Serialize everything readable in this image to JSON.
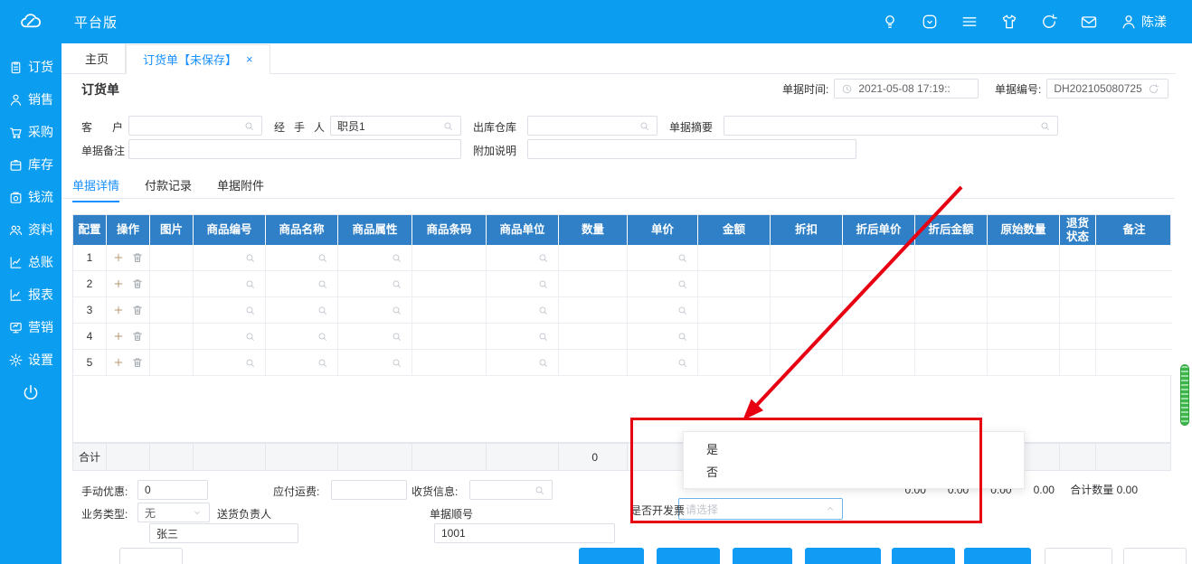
{
  "topbar": {
    "brand": "平台版",
    "user": "陈漾",
    "icons": [
      "bulb-icon",
      "checkbox-icon",
      "menu-icon",
      "shirt-icon",
      "refresh-icon",
      "mail-icon",
      "user-icon"
    ]
  },
  "sidebar": {
    "items": [
      {
        "label": "订货",
        "icon": "clipboard-icon"
      },
      {
        "label": "销售",
        "icon": "person-icon"
      },
      {
        "label": "采购",
        "icon": "cart-icon"
      },
      {
        "label": "库存",
        "icon": "box-icon"
      },
      {
        "label": "钱流",
        "icon": "cash-icon"
      },
      {
        "label": "资料",
        "icon": "people-icon"
      },
      {
        "label": "总账",
        "icon": "ledger-chart-icon"
      },
      {
        "label": "报表",
        "icon": "report-chart-icon"
      },
      {
        "label": "营销",
        "icon": "monitor-icon"
      },
      {
        "label": "设置",
        "icon": "gear-icon"
      }
    ]
  },
  "tabs": [
    {
      "label": "主页",
      "active": false
    },
    {
      "label": "订货单【未保存】",
      "active": true,
      "close": "×"
    }
  ],
  "page_title": "订货单",
  "doc_header": {
    "time_label": "单据时间:",
    "time_value": "2021-05-08 17:19::",
    "number_label": "单据编号:",
    "number_value": "DH202105080725"
  },
  "form": {
    "customer_label": "客 户",
    "customer_value": "",
    "handler_label": "经 手 人",
    "handler_value": "职员1",
    "warehouse_label": "出库仓库",
    "warehouse_value": "",
    "summary_label": "单据摘要",
    "summary_value": "",
    "remark_label": "单据备注",
    "remark_value": "",
    "extra_label": "附加说明",
    "extra_value": ""
  },
  "detail_tabs": [
    {
      "label": "单据详情",
      "active": true
    },
    {
      "label": "付款记录",
      "active": false
    },
    {
      "label": "单据附件",
      "active": false
    }
  ],
  "table": {
    "columns": [
      "配置",
      "操作",
      "图片",
      "商品编号",
      "商品名称",
      "商品属性",
      "商品条码",
      "商品单位",
      "数量",
      "单价",
      "金额",
      "折扣",
      "折后单价",
      "折后金额",
      "原始数量",
      "退货状态",
      "备注"
    ],
    "row_numbers": [
      "1",
      "2",
      "3",
      "4",
      "5"
    ],
    "search_columns": [
      3,
      4,
      5,
      7,
      9
    ],
    "total_label": "合计",
    "total_quantity": "0"
  },
  "footer": {
    "manual_discount_label": "手动优惠:",
    "manual_discount_value": "0",
    "freight_label": "应付运费:",
    "freight_value": "",
    "receiver_label": "收货信息:",
    "receiver_value": "",
    "biz_type_label": "业务类型:",
    "biz_type_value": "无",
    "delivery_label": "送货负责人",
    "delivery_value": "张三",
    "sequence_label": "单据顺号",
    "sequence_value": "1001",
    "invoice_label": "是否开发票",
    "invoice_placeholder": "请选择",
    "summary_fragments": "0.00　　0.00　　0.00　　0.00",
    "summary_total": "合计数量 0.00"
  },
  "invoice_dropdown": {
    "options": [
      "是",
      "否"
    ]
  },
  "colors": {
    "topbar_blue": "#0b9df0",
    "table_header_blue": "#2f80c7",
    "accent_blue": "#1890ff",
    "annotation_red": "#e60012",
    "scrollbar_green": "#3db54a"
  }
}
